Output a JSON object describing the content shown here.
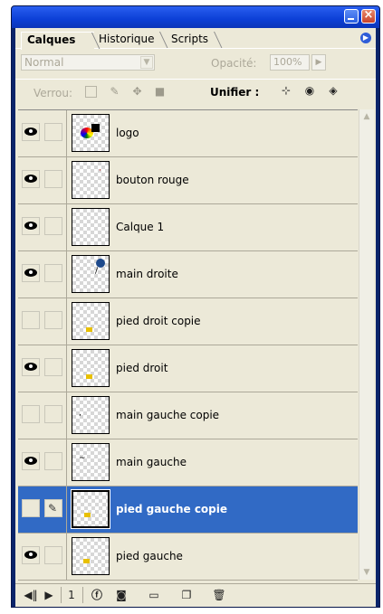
{
  "tabs": {
    "calques": "Calques",
    "historique": "Historique",
    "scripts": "Scripts"
  },
  "blend": {
    "mode": "Normal",
    "opacity_label": "Opacité:",
    "opacity_value": "100%"
  },
  "lock": {
    "label": "Verrou:",
    "unify_label": "Unifier :"
  },
  "layers": [
    {
      "name": "logo",
      "visible": true
    },
    {
      "name": "bouton rouge",
      "visible": true
    },
    {
      "name": "Calque  1",
      "visible": true
    },
    {
      "name": "main droite",
      "visible": true
    },
    {
      "name": "pied droit copie",
      "visible": false
    },
    {
      "name": "pied droit",
      "visible": true
    },
    {
      "name": "main gauche copie",
      "visible": false
    },
    {
      "name": "main gauche",
      "visible": true
    },
    {
      "name": "pied gauche copie",
      "visible": false,
      "selected": true
    },
    {
      "name": "pied gauche",
      "visible": true
    }
  ],
  "footer": {
    "frame_number": "1"
  },
  "colors": {
    "selection": "#316ac5",
    "panel": "#ece9d8",
    "titlebar": "#0c3fd6"
  }
}
